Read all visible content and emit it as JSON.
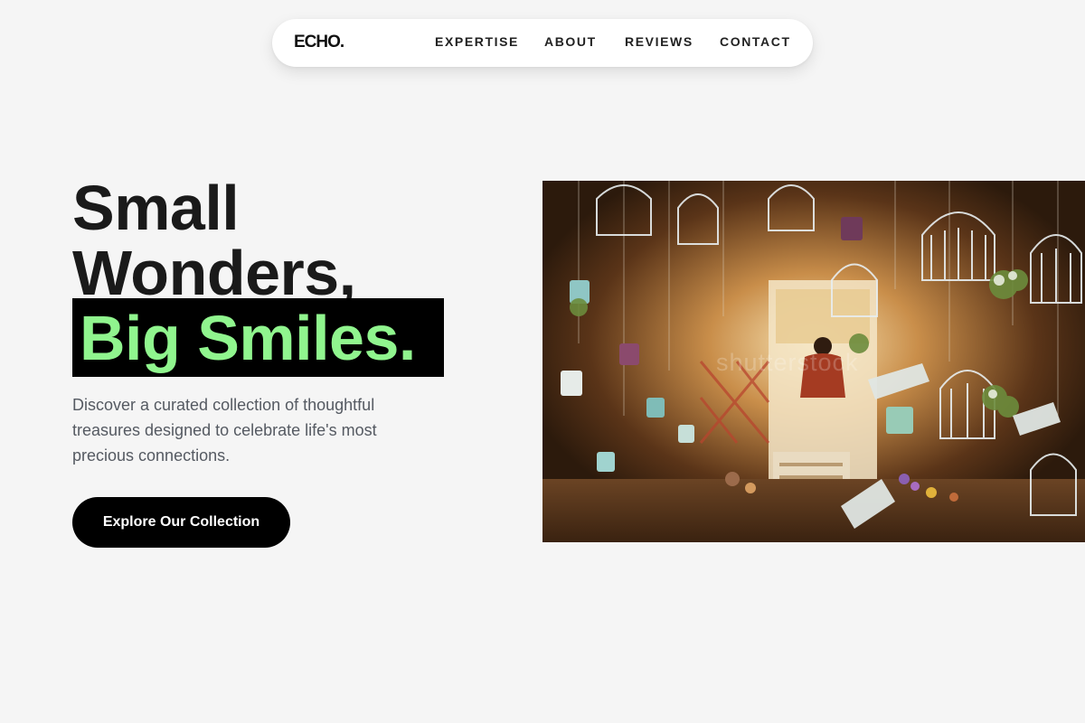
{
  "nav": {
    "logo": "ECHO.",
    "links": [
      "EXPERTISE",
      "ABOUT",
      "REVIEWS",
      "CONTACT"
    ]
  },
  "hero": {
    "headline_line1": "Small",
    "headline_line2": "Wonders,",
    "highlight": "Big Smiles.",
    "subtitle": "Discover a curated collection of thoughtful treasures designed to celebrate life's most precious connections.",
    "cta_label": "Explore Our Collection",
    "image_alt": "Shop filled with hanging decorative birdcages, mugs and watering cans",
    "watermark": "shutterstock"
  },
  "colors": {
    "accent_green": "#90f58e",
    "background": "#f5f5f5",
    "dark": "#000000"
  }
}
